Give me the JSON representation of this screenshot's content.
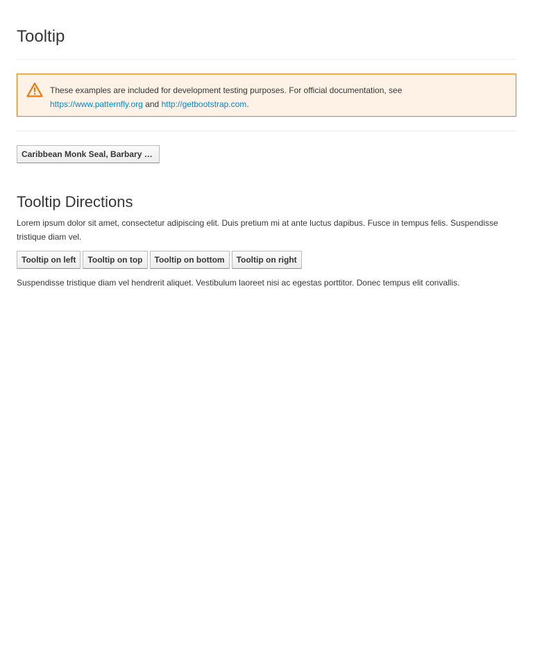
{
  "page": {
    "title": "Tooltip"
  },
  "alert": {
    "icon": "warning-triangle-icon",
    "text": "These examples are included for development testing purposes. For official documentation, see",
    "link1": "https://www.patternfly.org",
    "and": "and",
    "link2": "http://getbootstrap.com",
    "period": "."
  },
  "tooltip_button": {
    "label": "Caribbean Monk Seal, Barbary L..."
  },
  "directions": {
    "heading": "Tooltip Directions",
    "intro": "Lorem ipsum dolor sit amet, consectetur adipiscing elit. Duis pretium mi at ante luctus dapibus. Fusce in tempus felis. Suspendisse tristique diam vel.",
    "buttons": [
      "Tooltip on left",
      "Tooltip on top",
      "Tooltip on bottom",
      "Tooltip on right"
    ],
    "outro": "Suspendisse tristique diam vel hendrerit aliquet. Vestibulum laoreet nisi ac egestas porttitor. Donec tempus elit convallis."
  },
  "colors": {
    "warning": "#ec7a08",
    "link": "#0088ce"
  }
}
